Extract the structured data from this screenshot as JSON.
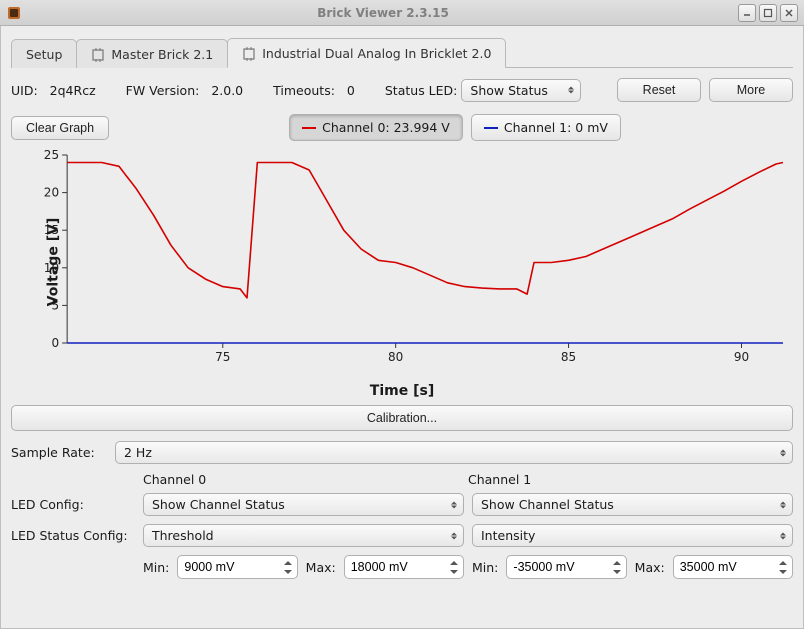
{
  "window": {
    "title": "Brick Viewer 2.3.15"
  },
  "tabs": [
    {
      "label": "Setup"
    },
    {
      "label": "Master Brick 2.1"
    },
    {
      "label": "Industrial Dual Analog In Bricklet 2.0"
    }
  ],
  "infobar": {
    "uid_label": "UID:",
    "uid_value": "2q4Rcz",
    "fw_label": "FW Version:",
    "fw_value": "2.0.0",
    "timeouts_label": "Timeouts:",
    "timeouts_value": "0",
    "status_led_label": "Status LED:",
    "status_led_value": "Show Status",
    "reset_label": "Reset",
    "more_label": "More"
  },
  "graph": {
    "clear_label": "Clear Graph",
    "channel0_label": "Channel 0: 23.994 V",
    "channel1_label": "Channel 1: 0 mV"
  },
  "chart_data": {
    "type": "line",
    "xlabel": "Time [s]",
    "ylabel": "Voltage [V]",
    "xlim": [
      70.5,
      91.2
    ],
    "ylim": [
      0,
      25
    ],
    "xticks": [
      75,
      80,
      85,
      90
    ],
    "yticks": [
      0,
      5,
      10,
      15,
      20,
      25
    ],
    "series": [
      {
        "name": "Channel 0",
        "color": "#d40000",
        "x": [
          70.5,
          71.0,
          71.5,
          72.0,
          72.5,
          73.0,
          73.5,
          74.0,
          74.5,
          75.0,
          75.5,
          75.7,
          76.0,
          76.7,
          77.0,
          77.5,
          78.0,
          78.5,
          79.0,
          79.5,
          80.0,
          80.5,
          81.0,
          81.5,
          82.0,
          82.5,
          83.0,
          83.5,
          83.8,
          84.0,
          84.5,
          85.0,
          85.5,
          86.0,
          86.5,
          87.0,
          87.5,
          88.0,
          88.5,
          89.0,
          89.5,
          90.0,
          90.5,
          91.0,
          91.2
        ],
        "y": [
          24.0,
          24.0,
          24.0,
          23.5,
          20.5,
          17.0,
          13.0,
          10.0,
          8.5,
          7.5,
          7.2,
          6.0,
          24.0,
          24.0,
          24.0,
          23.0,
          19.0,
          15.0,
          12.5,
          11.0,
          10.7,
          10.0,
          9.0,
          8.0,
          7.5,
          7.3,
          7.2,
          7.2,
          6.5,
          10.7,
          10.7,
          11.0,
          11.5,
          12.5,
          13.5,
          14.5,
          15.5,
          16.5,
          17.8,
          19.0,
          20.2,
          21.5,
          22.7,
          23.8,
          24.0
        ]
      },
      {
        "name": "Channel 1",
        "color": "#1020c0",
        "x": [
          70.5,
          91.2
        ],
        "y": [
          0,
          0
        ]
      }
    ]
  },
  "calibration": {
    "label": "Calibration..."
  },
  "sample_rate": {
    "label": "Sample Rate:",
    "value": "2 Hz"
  },
  "channels": {
    "header0": "Channel 0",
    "header1": "Channel 1",
    "led_config_label": "LED Config:",
    "led_config0": "Show Channel Status",
    "led_config1": "Show Channel Status",
    "led_status_config_label": "LED Status Config:",
    "led_status_config0": "Threshold",
    "led_status_config1": "Intensity",
    "min_label": "Min:",
    "max_label": "Max:",
    "min0": "9000 mV",
    "max0": "18000 mV",
    "min1": "-35000 mV",
    "max1": "35000 mV"
  }
}
